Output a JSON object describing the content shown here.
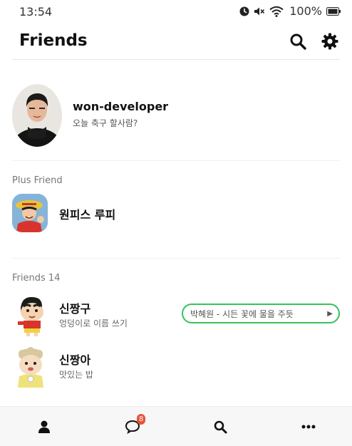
{
  "status_bar": {
    "time": "13:54",
    "battery": "100%",
    "icons": [
      "alarm-icon",
      "mute-icon",
      "wifi-icon",
      "battery-icon"
    ]
  },
  "header": {
    "title": "Friends",
    "search_icon": "search-icon",
    "settings_icon": "gear-icon"
  },
  "my_profile": {
    "name": "won-developer",
    "status": "오늘 축구 할사람?"
  },
  "plus_friend": {
    "section_label": "Plus Friend",
    "name": "원피스 루피"
  },
  "friends": {
    "section_label": "Friends 14",
    "items": [
      {
        "name": "신짱구",
        "status": "엉덩이로 이름 쓰기",
        "music": "박혜원 - 시든 꽃에 물을 주듯"
      },
      {
        "name": "신짱아",
        "status": "맛있는 밥"
      }
    ]
  },
  "tab_bar": {
    "tabs": [
      {
        "icon": "person-icon",
        "active": true
      },
      {
        "icon": "chat-bubble-icon",
        "badge": "8"
      },
      {
        "icon": "search-icon"
      },
      {
        "icon": "more-icon"
      }
    ]
  },
  "colors": {
    "music_border": "#35c25c",
    "badge": "#e4533c",
    "tab_bar_bg": "#f7f7f7"
  }
}
